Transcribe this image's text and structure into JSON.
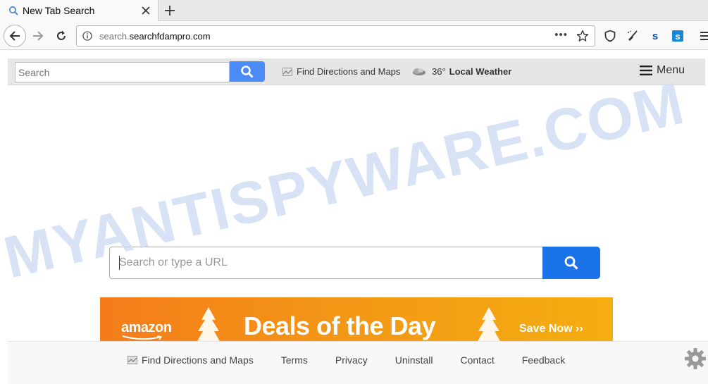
{
  "browser": {
    "tab": {
      "title": "New Tab Search"
    },
    "url": {
      "host_prefix": "search.",
      "host_domain": "searchfdampro.com"
    },
    "overflow_dots": "•••"
  },
  "topbar": {
    "search_placeholder": "Search",
    "directions_label": "Find Directions and Maps",
    "weather_temp": "36°",
    "weather_label": "Local Weather",
    "menu_label": "Menu"
  },
  "main_search": {
    "placeholder": "Search or type a URL"
  },
  "banner": {
    "brand": "amazon",
    "headline": "Deals of the Day",
    "cta": "Save Now ››"
  },
  "footer": {
    "directions": "Find Directions and Maps",
    "terms": "Terms",
    "privacy": "Privacy",
    "uninstall": "Uninstall",
    "contact": "Contact",
    "feedback": "Feedback"
  },
  "watermark": {
    "text": "MYANTISPYWARE.COM"
  },
  "colors": {
    "search_button": "#4a8bf5",
    "main_search_button": "#1a73e8",
    "banner_orange": "#f39616",
    "watermark": "#c9d8f0"
  }
}
